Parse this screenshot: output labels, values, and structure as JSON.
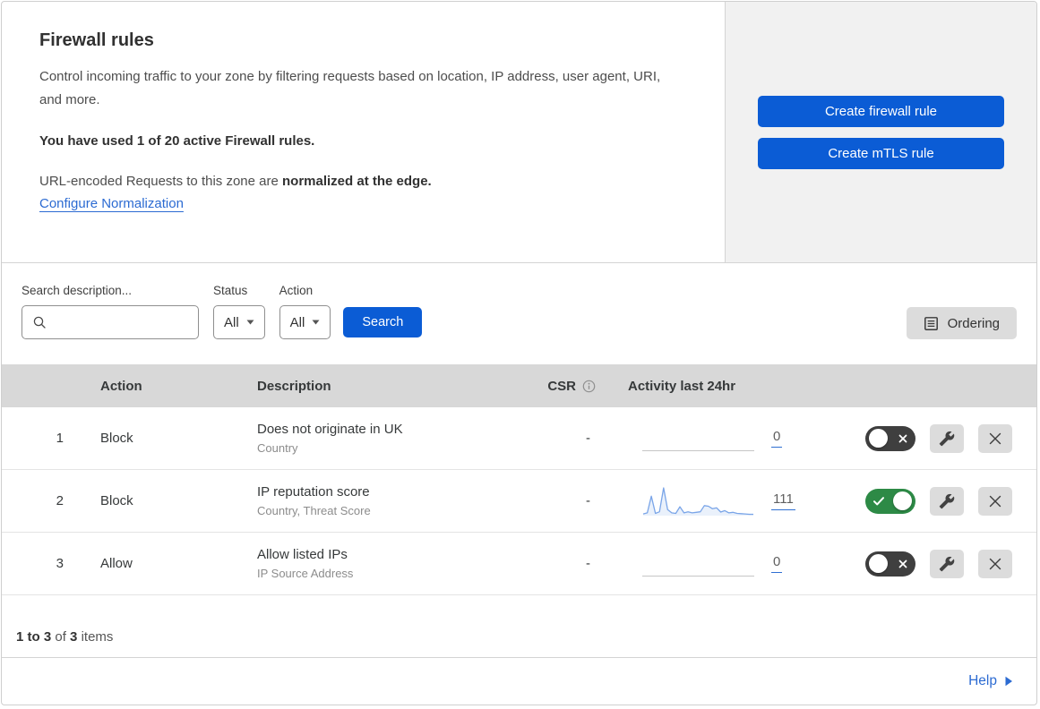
{
  "header": {
    "title": "Firewall rules",
    "description": "Control incoming traffic to your zone by filtering requests based on location, IP address, user agent, URI, and more.",
    "usage_note": "You have used 1 of 20 active Firewall rules.",
    "normalization_text": "URL-encoded Requests to this zone are ",
    "normalization_bold": "normalized at the edge.",
    "normalization_link": "Configure Normalization",
    "buttons": {
      "create_firewall": "Create firewall rule",
      "create_mtls": "Create mTLS rule"
    }
  },
  "filters": {
    "search_label": "Search description...",
    "status": {
      "label": "Status",
      "value": "All"
    },
    "action": {
      "label": "Action",
      "value": "All"
    },
    "search_button": "Search",
    "ordering_button": "Ordering"
  },
  "table": {
    "headers": {
      "action": "Action",
      "description": "Description",
      "csr": "CSR",
      "activity": "Activity last 24hr"
    },
    "rows": [
      {
        "index": "1",
        "action": "Block",
        "description": "Does not originate in UK",
        "expression_fields": "Country",
        "csr": "-",
        "activity_count": "0",
        "enabled": false,
        "has_sparkline": false
      },
      {
        "index": "2",
        "action": "Block",
        "description": "IP reputation score",
        "expression_fields": "Country, Threat Score",
        "csr": "-",
        "activity_count": "111",
        "enabled": true,
        "has_sparkline": true
      },
      {
        "index": "3",
        "action": "Allow",
        "description": "Allow listed IPs",
        "expression_fields": "IP Source Address",
        "csr": "-",
        "activity_count": "0",
        "enabled": false,
        "has_sparkline": false
      }
    ]
  },
  "footer": {
    "range": "1 to 3",
    "of": "of",
    "total": "3",
    "items": "items",
    "help": "Help"
  },
  "chart_data": {
    "type": "area",
    "title": "Activity last 24hr sparkline for rule 2 (IP reputation score)",
    "values": [
      6,
      10,
      70,
      8,
      14,
      100,
      22,
      10,
      8,
      32,
      10,
      14,
      10,
      12,
      14,
      36,
      34,
      25,
      28,
      13,
      18,
      10,
      12,
      8,
      7,
      6,
      5,
      5
    ],
    "ylim": [
      0,
      100
    ],
    "note": "Unlabeled mini area chart; relative request volume over the last 24 hours; linked total shown: 111. Rules 1 and 3 show a flat zero line.",
    "line_color": "#7aa5e8",
    "fill_color": "#eaf1fb",
    "legend": "off",
    "grid": "off"
  },
  "colors": {
    "primary_blue": "#0b5cd5",
    "link_blue": "#2c6bd2",
    "toggle_on_green": "#2d8a46",
    "toggle_off_gray": "#3f3f3f",
    "table_header_gray": "#d8d8d8",
    "side_panel_gray": "#f1f1f1"
  }
}
